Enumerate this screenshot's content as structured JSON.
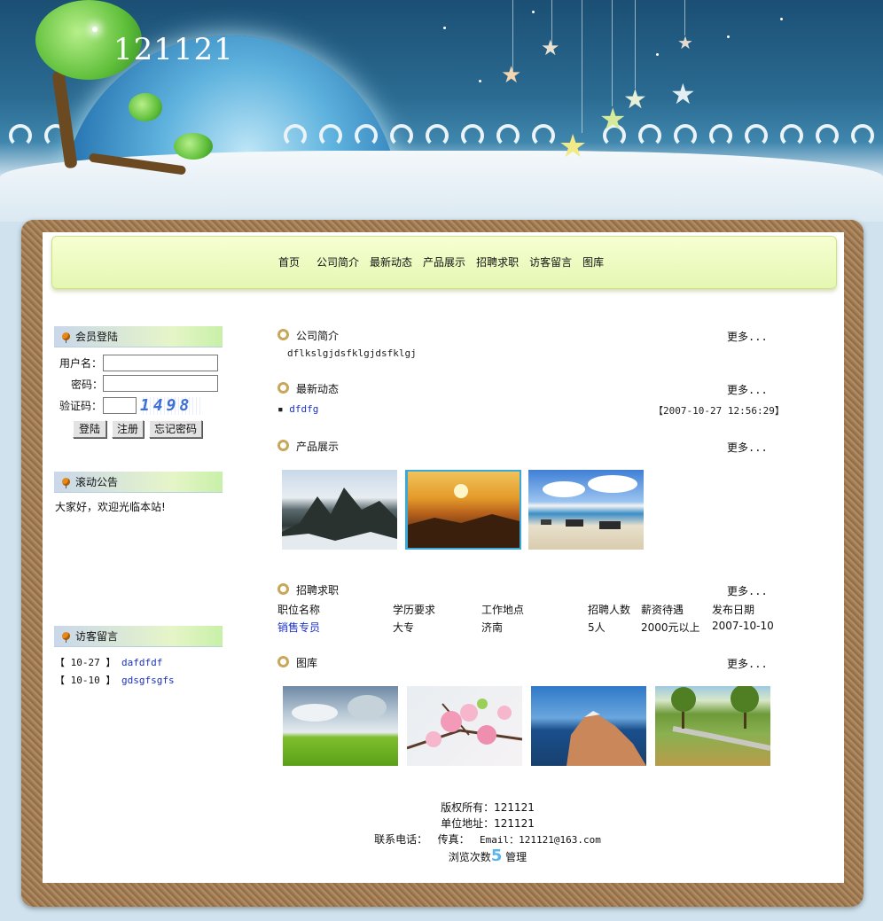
{
  "header": {
    "site_title": "121121"
  },
  "nav": {
    "items": [
      "首页",
      "公司简介",
      "最新动态",
      "产品展示",
      "招聘求职",
      "访客留言",
      "图库"
    ]
  },
  "login": {
    "heading": "会员登陆",
    "username_label": "用户名：",
    "password_label": "密码：",
    "captcha_label": "验证码：",
    "username_value": "",
    "password_value": "",
    "captcha_value": "",
    "captcha_image_text": "1498",
    "login_button": "登陆",
    "register_button": "注册",
    "forgot_button": "忘记密码"
  },
  "notice": {
    "heading": "滚动公告",
    "text": "大家好，欢迎光临本站!"
  },
  "guestbook": {
    "heading": "访客留言",
    "entries": [
      {
        "date": "【 10-27 】",
        "text": "dafdfdf"
      },
      {
        "date": "【 10-10 】",
        "text": "gdsgfsgfs"
      }
    ]
  },
  "sections": {
    "more_label": "更多...",
    "intro": {
      "title": "公司简介",
      "text": "dflkslgjdsfklgjdsfklgj"
    },
    "news": {
      "title": "最新动态",
      "bullet": "▪",
      "item": "dfdfg",
      "timestamp": "【2007-10-27 12:56:29】"
    },
    "products": {
      "title": "产品展示"
    },
    "jobs": {
      "title": "招聘求职",
      "headers": [
        "职位名称",
        "学历要求",
        "工作地点",
        "招聘人数",
        "薪资待遇",
        "发布日期"
      ],
      "rows": [
        [
          "销售专员",
          "大专",
          "济南",
          "5人",
          "2000元以上",
          "2007-10-10"
        ]
      ]
    },
    "gallery": {
      "title": "图库"
    }
  },
  "footer": {
    "copyright": "版权所有：121121",
    "address": "单位地址：121121",
    "phone_label": "联系电话：",
    "fax_label": "传真：",
    "email": "Email：121121@163.com",
    "visits_label": "浏览次数",
    "visits_count": "5",
    "admin_link": "管理"
  }
}
